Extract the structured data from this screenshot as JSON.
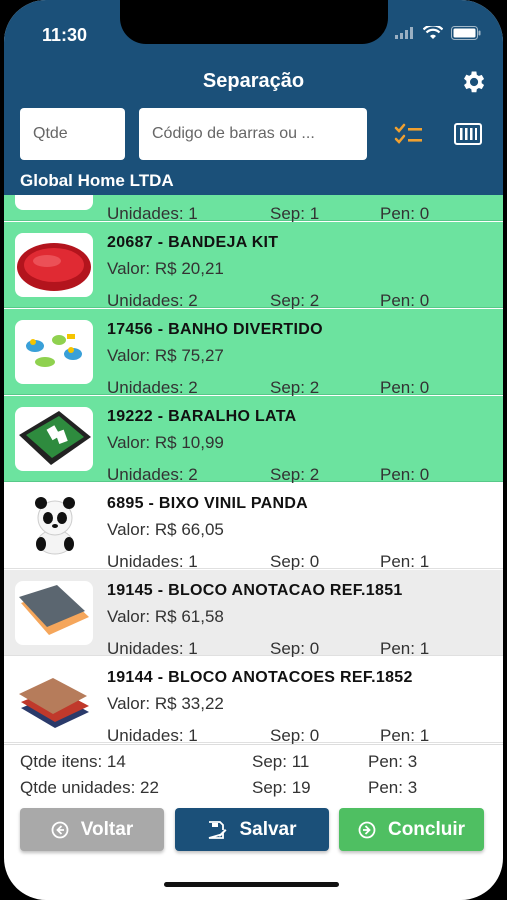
{
  "status_bar": {
    "time": "11:30"
  },
  "header": {
    "title": "Separação",
    "qtde_placeholder": "Qtde",
    "barcode_placeholder": "Código de barras ou ...",
    "company": "Global Home LTDA"
  },
  "partial_row": {
    "units": "Unidades: 1",
    "sep": "Sep: 1",
    "pen": "Pen: 0"
  },
  "items": [
    {
      "name": "20687 - BANDEJA KIT",
      "valor": "Valor: R$ 20,21",
      "units": "Unidades: 2",
      "sep": "Sep: 2",
      "pen": "Pen: 0",
      "status": "done"
    },
    {
      "name": "17456 - BANHO DIVERTIDO",
      "valor": "Valor: R$ 75,27",
      "units": "Unidades: 2",
      "sep": "Sep: 2",
      "pen": "Pen: 0",
      "status": "done"
    },
    {
      "name": "19222 - BARALHO LATA",
      "valor": "Valor: R$ 10,99",
      "units": "Unidades: 2",
      "sep": "Sep: 2",
      "pen": "Pen: 0",
      "status": "done"
    },
    {
      "name": "6895 - BIXO VINIL PANDA",
      "valor": "Valor: R$ 66,05",
      "units": "Unidades: 1",
      "sep": "Sep: 0",
      "pen": "Pen: 1",
      "status": "pending"
    },
    {
      "name": "19145 - BLOCO ANOTACAO REF.1851",
      "valor": "Valor: R$ 61,58",
      "units": "Unidades: 1",
      "sep": "Sep: 0",
      "pen": "Pen: 1",
      "status": "pending"
    },
    {
      "name": "19144 - BLOCO ANOTACOES REF.1852",
      "valor": "Valor: R$ 33,22",
      "units": "Unidades: 1",
      "sep": "Sep: 0",
      "pen": "Pen: 1",
      "status": "pending"
    }
  ],
  "summary": {
    "itens": "Qtde itens: 14",
    "itens_sep": "Sep: 11",
    "itens_pen": "Pen: 3",
    "unidades": "Qtde unidades: 22",
    "unidades_sep": "Sep: 19",
    "unidades_pen": "Pen: 3"
  },
  "buttons": {
    "voltar": "Voltar",
    "salvar": "Salvar",
    "concluir": "Concluir"
  },
  "colors": {
    "header": "#1b5079",
    "done_row": "#6ce39f",
    "voltar": "#a9a9a9",
    "salvar": "#1b5079",
    "concluir": "#4fbf62",
    "accent_icon": "#f0a030"
  },
  "icons": [
    "gear-icon",
    "list-check-icon",
    "barcode-icon",
    "arrow-left-circle-icon",
    "save-icon",
    "arrow-right-circle-icon"
  ]
}
